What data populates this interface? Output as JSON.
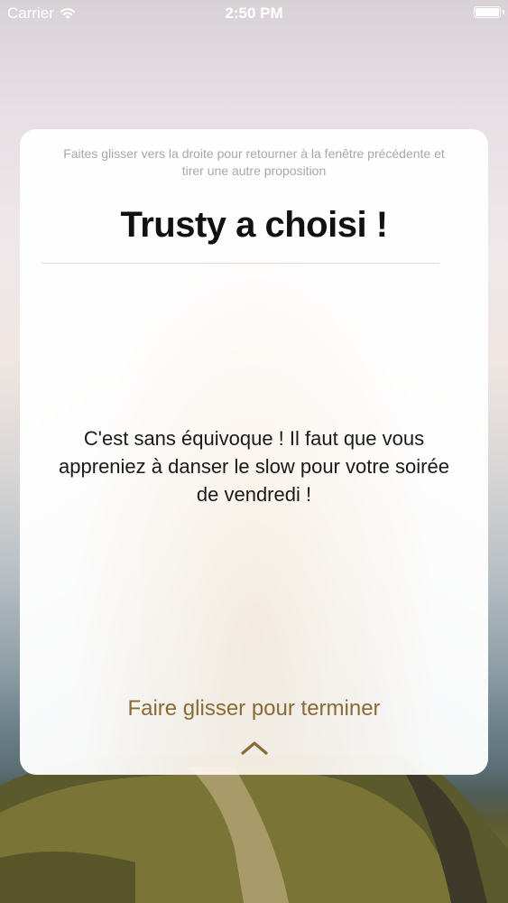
{
  "status_bar": {
    "carrier": "Carrier",
    "time": "2:50 PM",
    "wifi_icon": "wifi-icon",
    "battery_icon": "battery-icon",
    "battery_level": 1.0
  },
  "card": {
    "hint": "Faites glisser vers la droite pour retourner à la fenêtre précédente et tirer une autre proposition",
    "title": "Trusty a choisi !",
    "message": "C'est sans équivoque ! Il faut que vous appreniez à danser le slow pour votre soirée de vendredi !",
    "swipe_label": "Faire glisser pour terminer",
    "swipe_icon": "chevron-up-icon"
  },
  "colors": {
    "accent": "#8a6a36",
    "title": "#111111",
    "hint": "#a8a8a8",
    "card_background": "#ffffff"
  }
}
